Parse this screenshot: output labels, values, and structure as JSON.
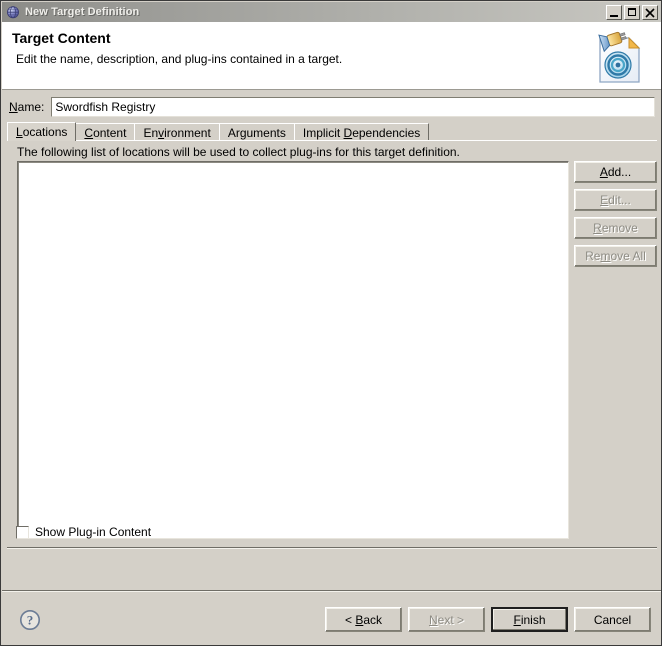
{
  "window": {
    "title": "New Target Definition",
    "title_icon": "globe-icon",
    "minimize_label": "Minimize",
    "maximize_label": "Maximize",
    "close_label": "Close",
    "titlebar_gradient_from": "#8b8b87",
    "titlebar_gradient_to": "#c9c8c2",
    "background": "#d4d0c8"
  },
  "banner": {
    "title": "Target Content",
    "description": "Edit the name, description, and plug-ins contained in a target.",
    "icon": "target-definition-document-icon",
    "background": "#ffffff"
  },
  "name_field": {
    "label_pre": "N",
    "label_mnemonic": "N",
    "label_rest": "ame:",
    "label_full": "Name:",
    "value": "Swordfish Registry",
    "placeholder": ""
  },
  "tabs": [
    {
      "label": "Locations",
      "mnemonic": "L",
      "before": "",
      "after": "ocations",
      "active": true
    },
    {
      "label": "Content",
      "mnemonic": "C",
      "before": "",
      "after": "ontent",
      "active": false
    },
    {
      "label": "Environment",
      "mnemonic": "v",
      "before": "En",
      "after": "ironment",
      "active": false
    },
    {
      "label": "Arguments",
      "mnemonic": "g",
      "before": "Ar",
      "after": "uments",
      "active": false
    },
    {
      "label": "Implicit Dependencies",
      "mnemonic": "D",
      "before": "Implicit ",
      "after": "ependencies",
      "active": false
    }
  ],
  "locations_tab": {
    "description": "The following list of locations will be used to collect plug-ins for this target definition.",
    "list_items": [],
    "list_empty": true,
    "buttons": [
      {
        "label": "Add...",
        "before": "A",
        "mnemonic": "",
        "after": "dd...",
        "enabled": true,
        "name": "add-button"
      },
      {
        "label": "Edit...",
        "before": "",
        "mnemonic": "E",
        "after": "dit...",
        "enabled": false,
        "name": "edit-button"
      },
      {
        "label": "Remove",
        "before": "",
        "mnemonic": "R",
        "after": "emove",
        "enabled": false,
        "name": "remove-button"
      },
      {
        "label": "Remove All",
        "before": "Re",
        "mnemonic": "m",
        "after": "ove All",
        "enabled": false,
        "name": "remove-all-button"
      }
    ]
  },
  "show_plugin_content": {
    "label": "Show Plug-in Content",
    "checked": false
  },
  "footer": {
    "help_icon": "help-question-icon",
    "buttons": [
      {
        "label": "< Back",
        "before": "< ",
        "mnemonic": "B",
        "after": "ack",
        "enabled": true,
        "is_default": false,
        "name": "back-button"
      },
      {
        "label": "Next >",
        "before": "",
        "mnemonic": "N",
        "after": "ext >",
        "enabled": false,
        "is_default": false,
        "name": "next-button"
      },
      {
        "label": "Finish",
        "before": "",
        "mnemonic": "F",
        "after": "inish",
        "enabled": true,
        "is_default": true,
        "name": "finish-button"
      },
      {
        "label": "Cancel",
        "before": "Cancel",
        "mnemonic": "",
        "after": "",
        "enabled": true,
        "is_default": false,
        "name": "cancel-button"
      }
    ]
  }
}
